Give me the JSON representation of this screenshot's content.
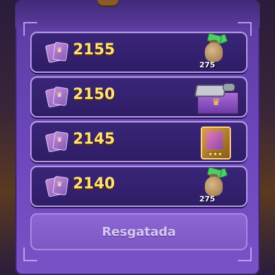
{
  "milestones": [
    {
      "value": "2155",
      "reward": "money-bag",
      "reward_amount": "275"
    },
    {
      "value": "2150",
      "reward": "chest",
      "reward_amount": ""
    },
    {
      "value": "2145",
      "reward": "card-badge",
      "reward_amount": "",
      "stars": "★★★"
    },
    {
      "value": "2140",
      "reward": "money-bag",
      "reward_amount": "275"
    }
  ],
  "claim_button": {
    "label": "Resgatada"
  },
  "colors": {
    "panel": "#6a45b8",
    "row": "#2e1d66",
    "value_text": "#ffe080",
    "button": "#8c66d4"
  }
}
